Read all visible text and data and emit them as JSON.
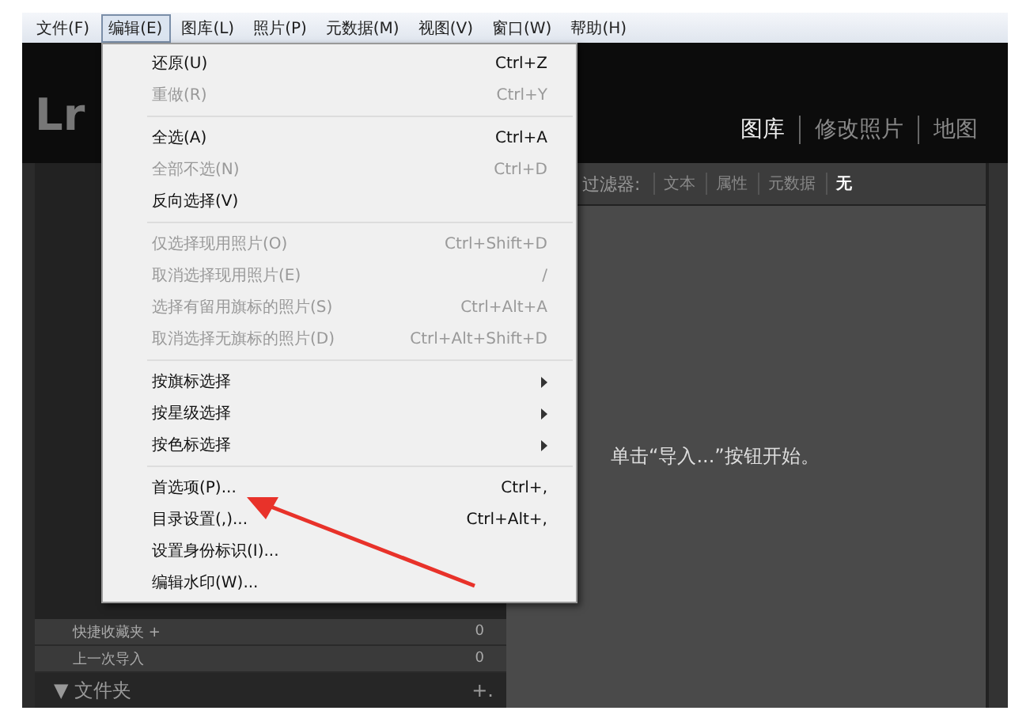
{
  "menu_bar": [
    {
      "label": "文件(F)",
      "selected": false
    },
    {
      "label": "编辑(E)",
      "selected": true
    },
    {
      "label": "图库(L)",
      "selected": false
    },
    {
      "label": "照片(P)",
      "selected": false
    },
    {
      "label": "元数据(M)",
      "selected": false
    },
    {
      "label": "视图(V)",
      "selected": false
    },
    {
      "label": "窗口(W)",
      "selected": false
    },
    {
      "label": "帮助(H)",
      "selected": false
    }
  ],
  "logo": "Lr",
  "modules": [
    {
      "label": "图库",
      "selected": true
    },
    {
      "label": "修改照片",
      "selected": false
    },
    {
      "label": "地图",
      "selected": false
    }
  ],
  "filter_bar": {
    "label": "过滤器:",
    "items": [
      {
        "label": "文本",
        "selected": false
      },
      {
        "label": "属性",
        "selected": false
      },
      {
        "label": "元数据",
        "selected": false
      },
      {
        "label": "无",
        "selected": true
      }
    ]
  },
  "left_panel": {
    "rows": [
      {
        "label": "快捷收藏夹 +",
        "count": "0"
      },
      {
        "label": "上一次导入",
        "count": "0"
      }
    ],
    "section": {
      "toggle": "▼",
      "label": "文件夹",
      "action": "+."
    }
  },
  "center_message": "单击“导入...”按钮开始。",
  "edit_menu": {
    "groups": [
      [
        {
          "kind": "item",
          "label": "还原(U)",
          "shortcut": "Ctrl+Z",
          "disabled": false
        },
        {
          "kind": "item",
          "label": "重做(R)",
          "shortcut": "Ctrl+Y",
          "disabled": true
        }
      ],
      [
        {
          "kind": "item",
          "label": "全选(A)",
          "shortcut": "Ctrl+A",
          "disabled": false
        },
        {
          "kind": "item",
          "label": "全部不选(N)",
          "shortcut": "Ctrl+D",
          "disabled": true
        },
        {
          "kind": "item",
          "label": "反向选择(V)",
          "disabled": false
        }
      ],
      [
        {
          "kind": "item",
          "label": "仅选择现用照片(O)",
          "shortcut": "Ctrl+Shift+D",
          "disabled": true
        },
        {
          "kind": "item",
          "label": "取消选择现用照片(E)",
          "shortcut": "/",
          "disabled": true
        },
        {
          "kind": "item",
          "label": "选择有留用旗标的照片(S)",
          "shortcut": "Ctrl+Alt+A",
          "disabled": true
        },
        {
          "kind": "item",
          "label": "取消选择无旗标的照片(D)",
          "shortcut": "Ctrl+Alt+Shift+D",
          "disabled": true
        }
      ],
      [
        {
          "kind": "submenu",
          "label": "按旗标选择",
          "disabled": false
        },
        {
          "kind": "submenu",
          "label": "按星级选择",
          "disabled": false
        },
        {
          "kind": "submenu",
          "label": "按色标选择",
          "disabled": false
        }
      ],
      [
        {
          "kind": "item",
          "label": "首选项(P)...",
          "shortcut": "Ctrl+,",
          "disabled": false
        },
        {
          "kind": "item",
          "label": "目录设置(,)...",
          "shortcut": "Ctrl+Alt+,",
          "disabled": false
        },
        {
          "kind": "item",
          "label": "设置身份标识(I)...",
          "disabled": false
        },
        {
          "kind": "item",
          "label": "编辑水印(W)...",
          "disabled": false
        }
      ]
    ]
  }
}
